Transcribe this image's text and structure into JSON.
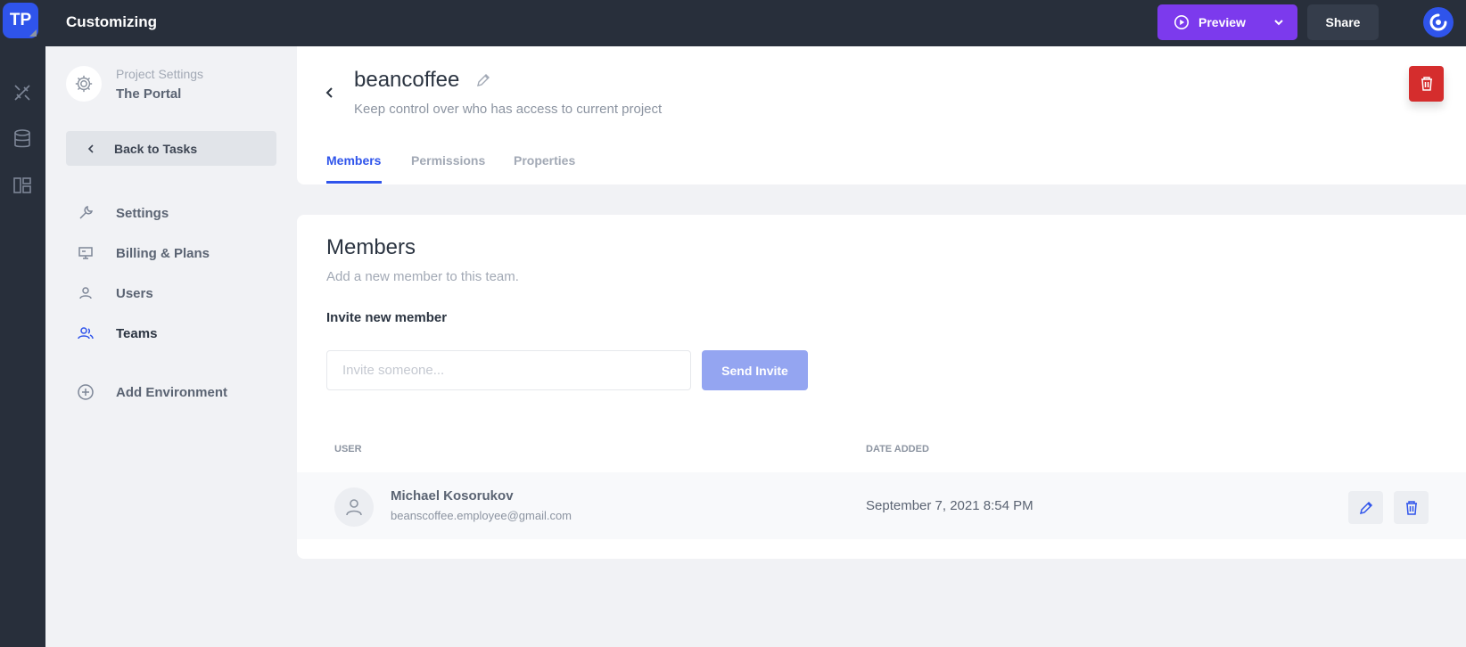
{
  "app": {
    "logo_text": "TP",
    "title": "Customizing",
    "preview_label": "Preview",
    "share_label": "Share"
  },
  "rail": {
    "icons": [
      "design-icon",
      "database-icon",
      "layout-icon"
    ]
  },
  "sidebar": {
    "project_label": "Project Settings",
    "project_name": "The Portal",
    "back_label": "Back to Tasks",
    "items": [
      {
        "label": "Settings",
        "icon": "wrench-icon"
      },
      {
        "label": "Billing & Plans",
        "icon": "billing-icon"
      },
      {
        "label": "Users",
        "icon": "user-icon"
      },
      {
        "label": "Teams",
        "icon": "team-icon",
        "active": true
      }
    ],
    "add_environment_label": "Add Environment"
  },
  "header": {
    "title": "beancoffee",
    "subtitle": "Keep control over who has access to current project",
    "tabs": [
      {
        "label": "Members",
        "active": true
      },
      {
        "label": "Permissions"
      },
      {
        "label": "Properties"
      }
    ]
  },
  "members": {
    "title": "Members",
    "subtitle": "Add a new member to this team.",
    "invite_label": "Invite new member",
    "invite_placeholder": "Invite someone...",
    "send_label": "Send Invite",
    "columns": [
      "USER",
      "DATE ADDED"
    ],
    "rows": [
      {
        "name": "Michael Kosorukov",
        "email": "beanscoffee.employee@gmail.com",
        "date_added": "September 7, 2021 8:54 PM"
      }
    ]
  },
  "colors": {
    "accent": "#2f54eb",
    "preview": "#7c3aed",
    "danger": "#d52d2d",
    "dark": "#282f3b"
  }
}
